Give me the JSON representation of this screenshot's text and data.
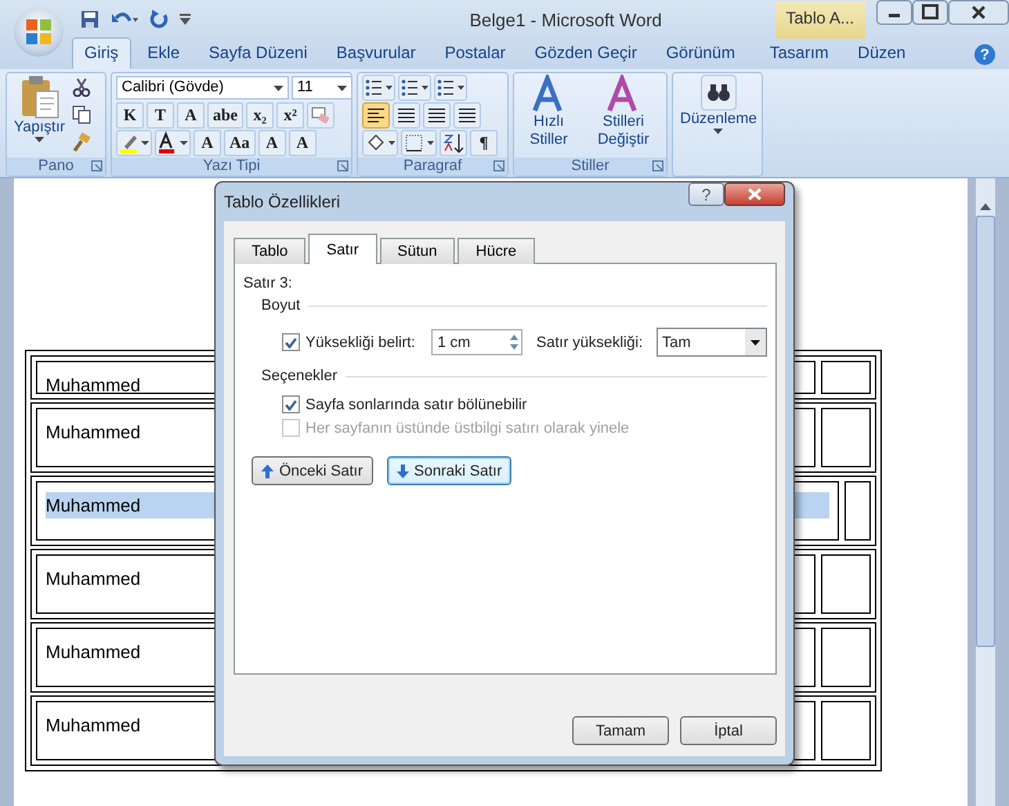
{
  "window": {
    "title": "Belge1 - Microsoft Word",
    "context_tab": "Tablo A...",
    "help": "?"
  },
  "tabs": [
    {
      "label": "Giriş",
      "selected": true
    },
    {
      "label": "Ekle",
      "selected": false
    },
    {
      "label": "Sayfa Düzeni",
      "selected": false
    },
    {
      "label": "Başvurular",
      "selected": false
    },
    {
      "label": "Postalar",
      "selected": false
    },
    {
      "label": "Gözden Geçir",
      "selected": false
    },
    {
      "label": "Görünüm",
      "selected": false
    },
    {
      "label": "Tasarım",
      "selected": false
    },
    {
      "label": "Düzen",
      "selected": false
    }
  ],
  "ribbon": {
    "paste": "Yapıştır",
    "clipboard_group": "Pano",
    "font_name": "Calibri (Gövde)",
    "font_size": "11",
    "font_buttons": [
      "K",
      "T",
      "A",
      "abe",
      "x₂",
      "x²"
    ],
    "font_buttons_2": [
      "A",
      "Aa",
      "A",
      "A"
    ],
    "font_group": "Yazı Tipi",
    "pilcrow": "¶",
    "paragraph_group": "Paragraf",
    "quick_styles": "Hızlı Stiller",
    "change_styles": "Stilleri Değiştir",
    "styles_group": "Stiller",
    "editing": "Düzenleme"
  },
  "document": {
    "rows": [
      {
        "text": "Muhammed",
        "selected": false
      },
      {
        "text": "Muhammed",
        "selected": false
      },
      {
        "text": "Muhammed",
        "selected": true
      },
      {
        "text": "Muhammed",
        "selected": false
      },
      {
        "text": "Muhammed",
        "selected": false
      },
      {
        "text": "Muhammed",
        "selected": false
      }
    ]
  },
  "dialog": {
    "title": "Tablo Özellikleri",
    "help": "?",
    "tabs": [
      {
        "label": "Tablo",
        "selected": false
      },
      {
        "label": "Satır",
        "selected": true
      },
      {
        "label": "Sütun",
        "selected": false
      },
      {
        "label": "Hücre",
        "selected": false
      }
    ],
    "row_label": "Satır 3:",
    "size_section": "Boyut",
    "specify_height": {
      "label": "Yüksekliği belirt:",
      "checked": true,
      "value": "1 cm"
    },
    "row_height_label": "Satır yüksekliği:",
    "row_height_value": "Tam",
    "options_section": "Seçenekler",
    "options": [
      {
        "label": "Sayfa sonlarında satır bölünebilir",
        "checked": true,
        "disabled": false
      },
      {
        "label": "Her sayfanın üstünde üstbilgi satırı olarak yinele",
        "checked": false,
        "disabled": true
      }
    ],
    "previous_row": "Önceki Satır",
    "next_row": "Sonraki Satır",
    "ok": "Tamam",
    "cancel": "İptal"
  }
}
